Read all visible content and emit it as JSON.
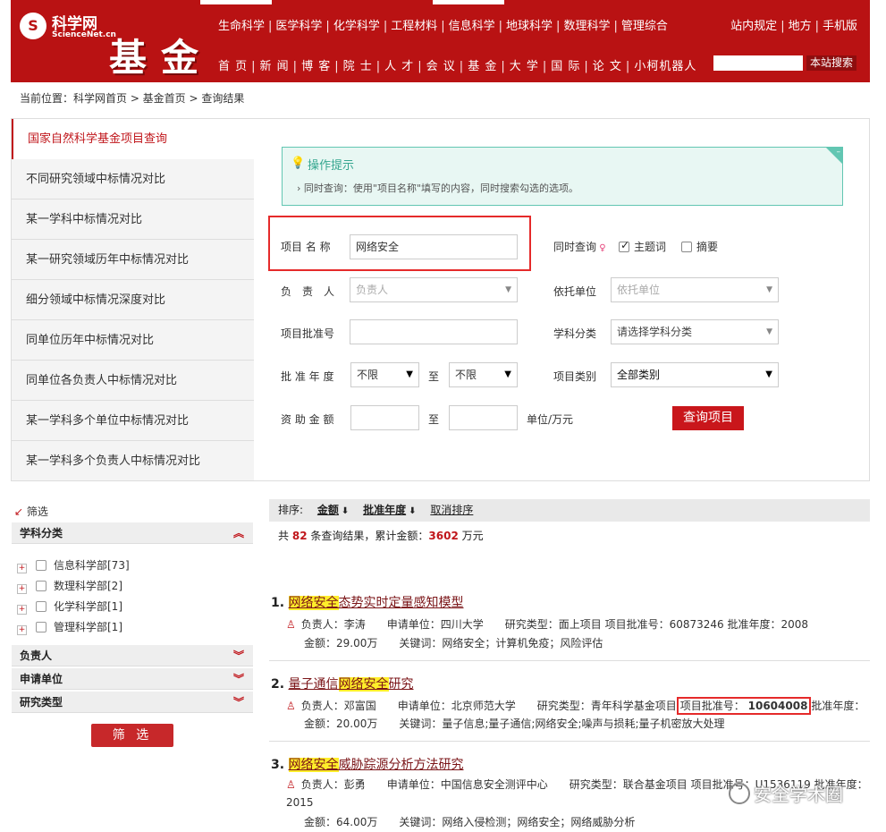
{
  "header": {
    "logo_name": "科学网",
    "logo_sub": "ScienceNet.cn",
    "section_title": "基金",
    "subject_nav": [
      "生命科学",
      "医学科学",
      "化学科学",
      "工程材料",
      "信息科学",
      "地球科学",
      "数理科学",
      "管理综合"
    ],
    "main_nav": [
      "首 页",
      "新 闻",
      "博 客",
      "院 士",
      "人 才",
      "会 议",
      "基 金",
      "大 学",
      "国 际",
      "论 文",
      "小柯机器人"
    ],
    "top_links": [
      "站内规定",
      "地方",
      "手机版"
    ],
    "search_button": "本站搜索",
    "search_value": ""
  },
  "breadcrumb": "当前位置：科学网首页 > 基金首页 > 查询结果",
  "sidebar": {
    "items": [
      {
        "label": "国家自然科学基金项目查询",
        "active": true
      },
      {
        "label": "不同研究领域中标情况对比"
      },
      {
        "label": "某一学科中标情况对比"
      },
      {
        "label": "某一研究领域历年中标情况对比"
      },
      {
        "label": "细分领域中标情况深度对比"
      },
      {
        "label": "同单位历年中标情况对比"
      },
      {
        "label": "同单位各负责人中标情况对比"
      },
      {
        "label": "某一学科多个单位中标情况对比"
      },
      {
        "label": "某一学科多个负责人中标情况对比"
      }
    ]
  },
  "tip": {
    "title": "操作提示",
    "body": "› 同时查询：使用\"项目名称\"填写的内容，同时搜索勾选的选项。",
    "close": "–"
  },
  "form": {
    "project_name_label": "项目 名 称",
    "project_name_value": "网络安全",
    "simul_label": "同时查询",
    "opt_keyword": "主题词",
    "opt_abstract": "摘要",
    "leader_label": "负　责　人",
    "leader_placeholder": "负责人",
    "unit_label": "依托单位",
    "unit_placeholder": "依托单位",
    "approval_no_label": "项目批准号",
    "subject_label": "学科分类",
    "subject_placeholder": "请选择学科分类",
    "year_label": "批 准 年 度",
    "year_from": "不限",
    "to": "至",
    "year_to": "不限",
    "type_label": "项目类别",
    "type_value": "全部类别",
    "amount_label": "资 助 金 额",
    "amount_to": "至",
    "amount_unit": "单位/万元",
    "query_button": "查询项目"
  },
  "filters": {
    "head": "筛选",
    "subject_title": "学科分类",
    "subject_items": [
      "信息科学部[73]",
      "数理科学部[2]",
      "化学科学部[1]",
      "管理科学部[1]"
    ],
    "blocks": [
      "负责人",
      "申请单位",
      "研究类型"
    ],
    "button": "筛 选"
  },
  "sort": {
    "label": "排序:",
    "amount": "金额",
    "year": "批准年度",
    "cancel": "取消排序",
    "arrow": "⬇"
  },
  "summary": {
    "pre": "共",
    "count": "82",
    "mid": "条查询结果，累计金额：",
    "amount": "3602",
    "unit": "万元"
  },
  "results": [
    {
      "num": "1.",
      "title_pre": "",
      "title_hl": "网络安全",
      "title_post": "态势实时定量感知模型",
      "line1": "负责人：李涛　　申请单位：四川大学　　研究类型：面上项目 项目批准号：60873246 批准年度：2008",
      "line2": "金额：29.00万　　关键词：网络安全；计算机免疫；风险评估"
    },
    {
      "num": "2.",
      "title_pre": "量子通信",
      "title_hl": "网络安全",
      "title_post": "研究",
      "line1_a": "负责人：邓富国　　申请单位：北京师范大学　　研究类型：青年科学基金项目",
      "line1_b": "项目批准号：",
      "line1_c": "10604008",
      "line1_d": "批准年度：",
      "line2": "金额：20.00万　　关键词：量子信息;量子通信;网络安全;噪声与损耗;量子机密放大处理"
    },
    {
      "num": "3.",
      "title_pre": "",
      "title_hl": "网络安全",
      "title_post": "威胁踪源分析方法研究",
      "line1": "负责人：彭勇　　申请单位：中国信息安全测评中心　　研究类型：联合基金项目 项目批准号：U1536119 批准年度：",
      "line1b": "2015",
      "line2": "金额：64.00万　　关键词：网络入侵检测；网络安全；网络威胁分析"
    }
  ],
  "watermark": "安全学术圈"
}
